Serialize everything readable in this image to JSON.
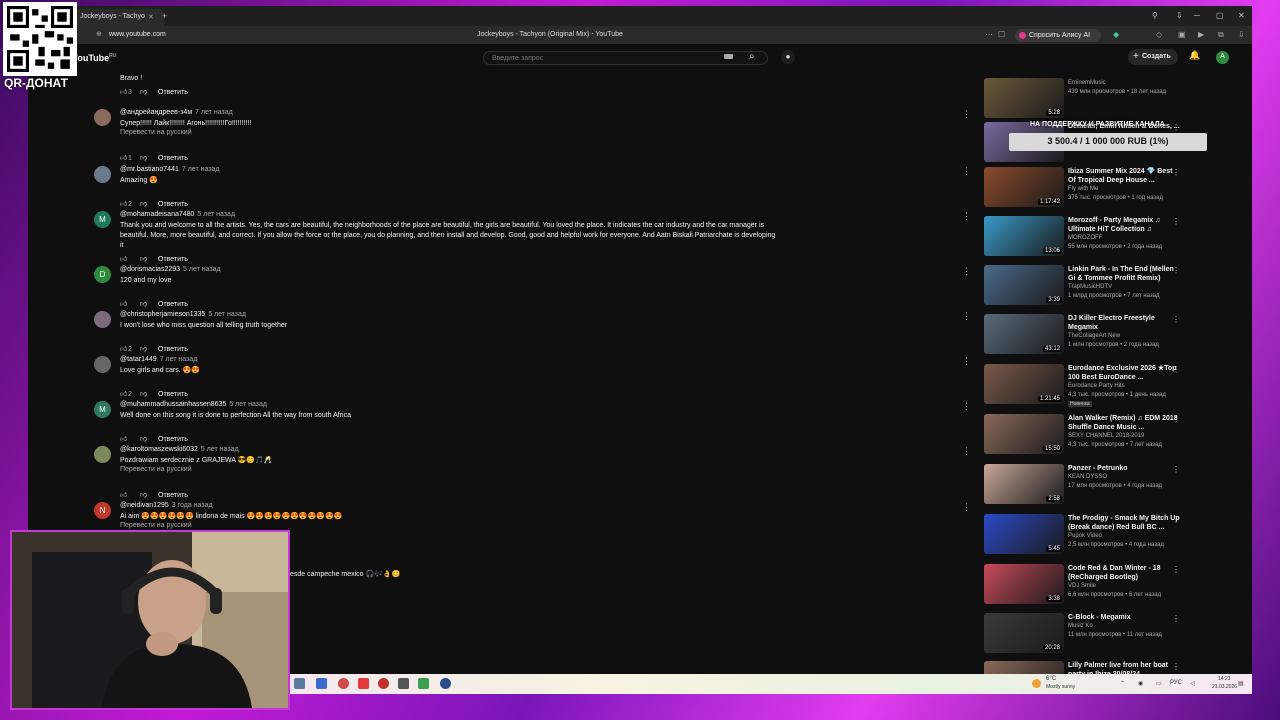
{
  "overlay": {
    "qr_label": "QR-ДОНАТ",
    "donation_caption": "НА ПОДДЕРЖКУ И РАЗВИТИЕ КАНАЛА",
    "donation_progress": "3 500.4 / 1 000 000 RUB (1%)",
    "donation_fraction": 0.01
  },
  "browser": {
    "tab_title": "Jockeyboys - Tachyo",
    "url": "www.youtube.com",
    "page_title": "Jockeyboys - Tachyon (Original Mix) - YouTube",
    "alice_label": "Спросить Алису AI"
  },
  "youtube": {
    "logo": "YouTube",
    "logo_region": "RU",
    "search_placeholder": "Введите запрос",
    "create_label": "Создать",
    "avatar_letter": "A"
  },
  "comments": [
    {
      "avatar": "",
      "handle": "",
      "time": "",
      "text": "Bravo !",
      "translate": "",
      "likes": "3",
      "reply": "Ответить"
    },
    {
      "avatar": "",
      "handle": "@андрейандреев-з4м",
      "time": "7 лет назад",
      "text": "Супер!!!!!! Лайк!!!!!!!! Агонь!!!!!!!!!!Го!!!!!!!!!!",
      "translate": "Перевести на русский",
      "likes": "1",
      "reply": "Ответить"
    },
    {
      "avatar": "",
      "handle": "@mr.bastiano7441",
      "time": "7 лет назад",
      "text": "Amazing 😍",
      "translate": "",
      "likes": "2",
      "reply": "Ответить"
    },
    {
      "avatar": "M",
      "handle": "@mohamadeisana7480",
      "time": "5 лет назад",
      "text": "Thank you and welcome to all the artists. Yes, the cars are beautiful, the neighborhoods of the place are beautiful, the girls are beautiful. You loved the place. It indicates the car industry and the car manager is beautiful. More, more beautiful, and correct. If you allow the force or the place, you do planning, and then install and develop. Good, good and helpful work for everyone. And Aatn Biskali Patriarchate is developing it",
      "translate": "",
      "likes": "",
      "reply": "Ответить"
    },
    {
      "avatar": "D",
      "handle": "@dorismacias2293",
      "time": "5 лет назад",
      "text": "120 and my love",
      "translate": "",
      "likes": "",
      "reply": "Ответить"
    },
    {
      "avatar": "",
      "handle": "@christopherjamieson1335",
      "time": "5 лет назад",
      "text": "I won't lose who miss question all telling truth together",
      "translate": "",
      "likes": "2",
      "reply": "Ответить"
    },
    {
      "avatar": "",
      "handle": "@tatar1449",
      "time": "7 лет назад",
      "text": "Love girls and cars. 😍😍",
      "translate": "",
      "likes": "2",
      "reply": "Ответить"
    },
    {
      "avatar": "M",
      "handle": "@muhammadhussainhassen8635",
      "time": "5 лет назад",
      "text": "Well done on this song it is done to perfection All the way from south Africa",
      "translate": "",
      "likes": "",
      "reply": "Ответить"
    },
    {
      "avatar": "",
      "handle": "@karoltomaszewski6032",
      "time": "5 лет назад",
      "text": "Pozdrawiam serdecznie z GRAJEWA 😎😊🎵🥂",
      "translate": "Перевести на русский",
      "likes": "",
      "reply": "Ответить"
    },
    {
      "avatar": "N",
      "handle": "@neidivan1295",
      "time": "3 года назад",
      "text": "Ai aim 😍😍😍😍😍😍 lindona de mais 😍😍😍😍😍😍😍😍😍😍😍",
      "translate": "Перевести на русский",
      "likes": "",
      "reply": ""
    }
  ],
  "partial_comment": "esde campeche mexico 🎧🎶👌😊",
  "sidebar": [
    {
      "title": "",
      "channel": "EminemMusic",
      "meta": "439 млн просмотров • 18 лет назад",
      "duration": "5:28",
      "thumb": "#6a5a3a",
      "badge": ""
    },
    {
      "title": "Demeter, Emin Nilsen & Bones, ...",
      "channel": "",
      "meta": "",
      "duration": "",
      "thumb": "#7a6aa0",
      "badge": ""
    },
    {
      "title": "Ibiza Summer Mix 2024 💎 Best Of Tropical Deep House ...",
      "channel": "Fly with Me",
      "meta": "375 тыс. просмотров • 1 год назад",
      "duration": "1:17:42",
      "thumb": "#8a4a2a",
      "badge": ""
    },
    {
      "title": "Morozoff - Party Megamix ♫ Ultimate HiT Collection ♫",
      "channel": "MOROZOFF",
      "meta": "55 млн просмотров • 2 года назад",
      "duration": "13:06",
      "thumb": "#3a9ac8",
      "badge": ""
    },
    {
      "title": "Linkin Park - In The End (Mellen Gi & Tommee Profitt Remix)",
      "channel": "TrapMusicHDTV",
      "meta": "1 млрд просмотров • 7 лет назад",
      "duration": "3:39",
      "thumb": "#4a6a8a",
      "badge": ""
    },
    {
      "title": "DJ Killer Electro Freestyle Megamix",
      "channel": "TheCollageArt New",
      "meta": "1 млн просмотров • 2 года назад",
      "duration": "43:12",
      "thumb": "#5a6a7a",
      "badge": ""
    },
    {
      "title": "Eurodance Exclusive 2026 ★Top 100 Best EuroDance ...",
      "channel": "Eurodance Party Hits",
      "meta": "4,3 тыс. просмотров • 1 день назад",
      "duration": "1:21:45",
      "thumb": "#7a5a4a",
      "badge": "Новинка"
    },
    {
      "title": "Alan Walker (Remix) ♫ EDM 2018  Shuffle Dance Music ...",
      "channel": "SEXY CHANNEL 2018-2019",
      "meta": "4,3 тыс. просмотров • 7 лет назад",
      "duration": "15:50",
      "thumb": "#8a6a5a",
      "badge": ""
    },
    {
      "title": "Panzer - Petrunko",
      "channel": "KEAN DYSSO",
      "meta": "17 млн просмотров • 4 года назад",
      "duration": "2:58",
      "thumb": "#c8a898",
      "badge": ""
    },
    {
      "title": "The Prodigy - Smack My Bitch Up (Break dance) Red Bull BC ...",
      "channel": "Pupok Video",
      "meta": "2,5 млн просмотров • 4 года назад",
      "duration": "5:45",
      "thumb": "#2a4ac8",
      "badge": ""
    },
    {
      "title": "Code Red & Dan Winter - 18 (ReCharged Bootleg)",
      "channel": "VDJ Smile",
      "meta": "6,6 млн просмотров • 6 лет назад",
      "duration": "3:38",
      "thumb": "#c84a5a",
      "badge": ""
    },
    {
      "title": "C-Block - Megamix",
      "channel": "Musiz Ko",
      "meta": "11 млн просмотров • 11 лет назад",
      "duration": "20:28",
      "thumb": "#3a3a3a",
      "badge": ""
    },
    {
      "title": "Lilly Palmer live from her boat party in Ibiza 20/08/24",
      "channel": "",
      "meta": "",
      "duration": "",
      "thumb": "#8a6a5a",
      "badge": ""
    }
  ],
  "taskbar": {
    "weather_temp": "6°C",
    "weather_desc": "Mostly sunny",
    "lang": "РУС",
    "time": "14:21",
    "date": "21.03.2026"
  }
}
